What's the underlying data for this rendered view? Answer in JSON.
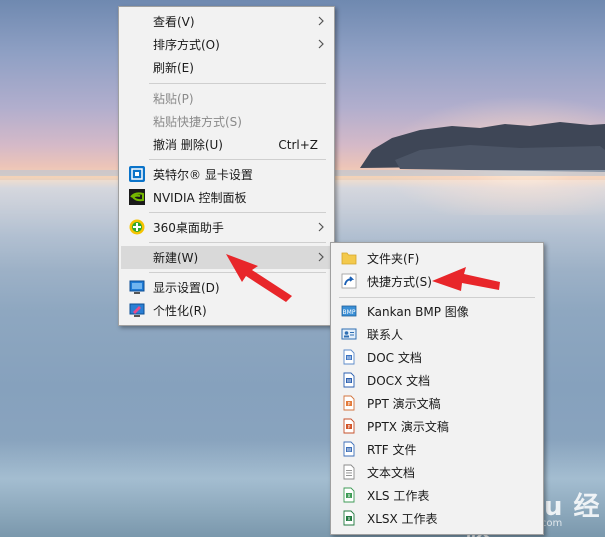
{
  "main_menu": {
    "items": [
      {
        "label": "查看(V)"
      },
      {
        "label": "排序方式(O)"
      },
      {
        "label": "刷新(E)"
      },
      {
        "label": "粘贴(P)"
      },
      {
        "label": "粘贴快捷方式(S)"
      },
      {
        "label": "撤消 删除(U)",
        "shortcut": "Ctrl+Z"
      },
      {
        "label": "英特尔® 显卡设置"
      },
      {
        "label": "NVIDIA 控制面板"
      },
      {
        "label": "360桌面助手"
      },
      {
        "label": "新建(W)"
      },
      {
        "label": "显示设置(D)"
      },
      {
        "label": "个性化(R)"
      }
    ]
  },
  "sub_menu": {
    "items": [
      {
        "label": "文件夹(F)",
        "icon": "folder-icon"
      },
      {
        "label": "快捷方式(S)",
        "icon": "shortcut-icon"
      },
      {
        "label": "Kankan BMP 图像",
        "icon": "bmp-image-icon"
      },
      {
        "label": "联系人",
        "icon": "contact-icon"
      },
      {
        "label": "DOC 文档",
        "icon": "doc-icon"
      },
      {
        "label": "DOCX 文档",
        "icon": "docx-icon"
      },
      {
        "label": "PPT 演示文稿",
        "icon": "ppt-icon"
      },
      {
        "label": "PPTX 演示文稿",
        "icon": "pptx-icon"
      },
      {
        "label": "RTF 文件",
        "icon": "rtf-icon"
      },
      {
        "label": "文本文档",
        "icon": "text-document-icon"
      },
      {
        "label": "XLS 工作表",
        "icon": "xls-icon"
      },
      {
        "label": "XLSX 工作表",
        "icon": "xlsx-icon"
      }
    ]
  },
  "watermark": {
    "text": "Bai du 经验",
    "sub": "jingyan.baidu.com"
  },
  "colors": {
    "menu_bg": "#f2f2f2",
    "active_bg": "#d9d9d9",
    "annotation_red": "#e8262a",
    "disabled_text": "#8a8a8a"
  }
}
